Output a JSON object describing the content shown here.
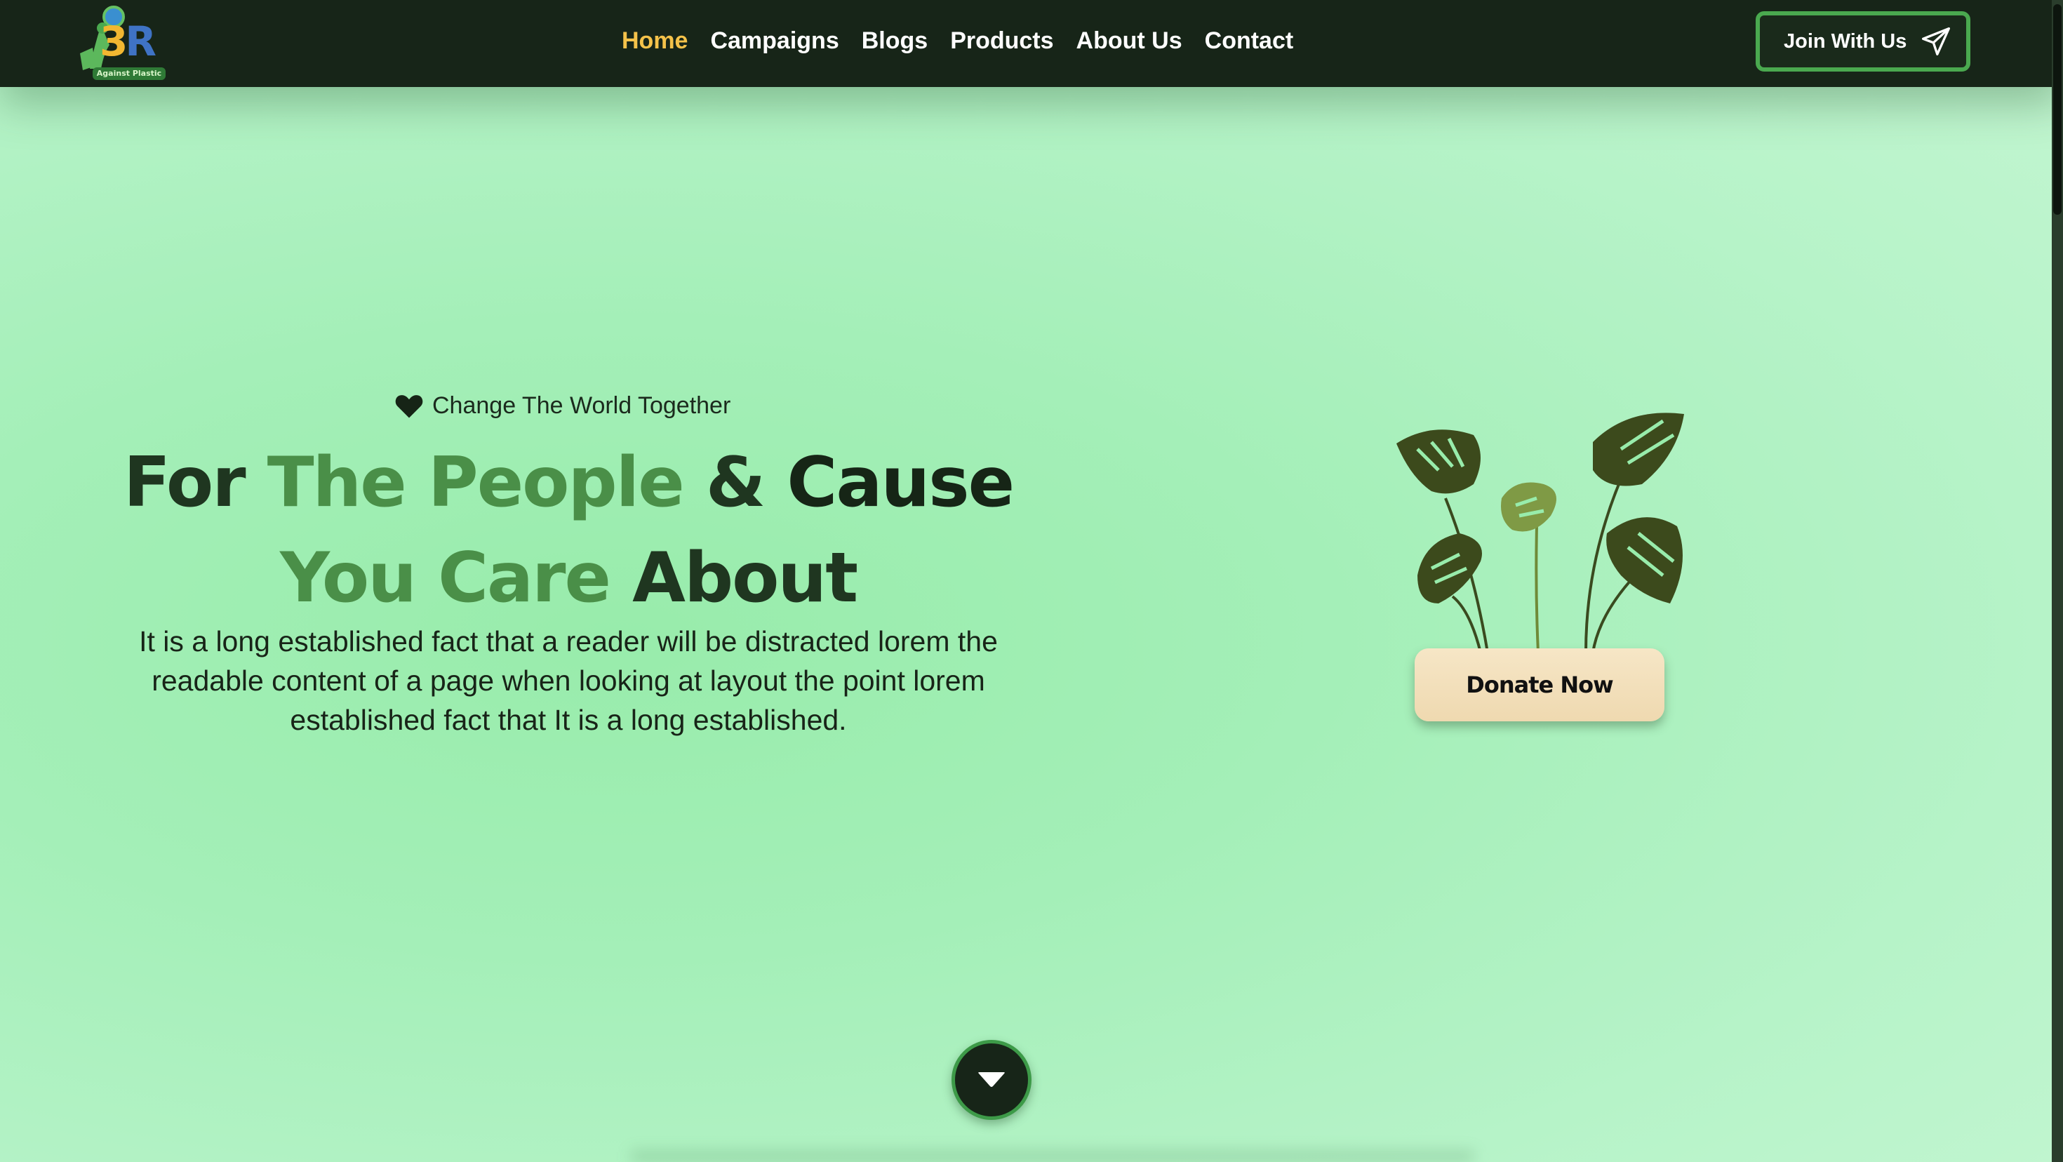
{
  "nav": {
    "logo": {
      "main_text_digit": "3",
      "main_text_letter": "R",
      "tagline": "Against Plastic"
    },
    "links": [
      {
        "label": "Home",
        "active": true
      },
      {
        "label": "Campaigns",
        "active": false
      },
      {
        "label": "Blogs",
        "active": false
      },
      {
        "label": "Products",
        "active": false
      },
      {
        "label": "About Us",
        "active": false
      },
      {
        "label": "Contact",
        "active": false
      }
    ],
    "cta": {
      "label": "Join With Us",
      "icon": "paper-plane-icon"
    }
  },
  "hero": {
    "tagline": {
      "icon": "heart-icon",
      "text": "Change The World Together"
    },
    "headline": {
      "line1_part1": "For ",
      "line1_part2": "The People",
      "line1_part3": " & ",
      "line1_part4": "Cause",
      "line2_part1": "You Care ",
      "line2_part2": "About"
    },
    "description": "It is a long established fact that a reader will be distracted lorem the readable content of a page when looking at layout the point lorem established fact that It is a long established.",
    "donate": {
      "label": "Donate Now",
      "illustration": "potted-monstera-plant"
    },
    "scroll_down": {
      "icon": "caret-down-icon"
    }
  },
  "colors": {
    "navbar_bg": "#172518",
    "active_link": "#f4c24a",
    "accent_green": "#4aa94f",
    "headline_dark": "#1f3620",
    "headline_mid": "#4a8f48",
    "donate_bg": "#f3dfba"
  }
}
